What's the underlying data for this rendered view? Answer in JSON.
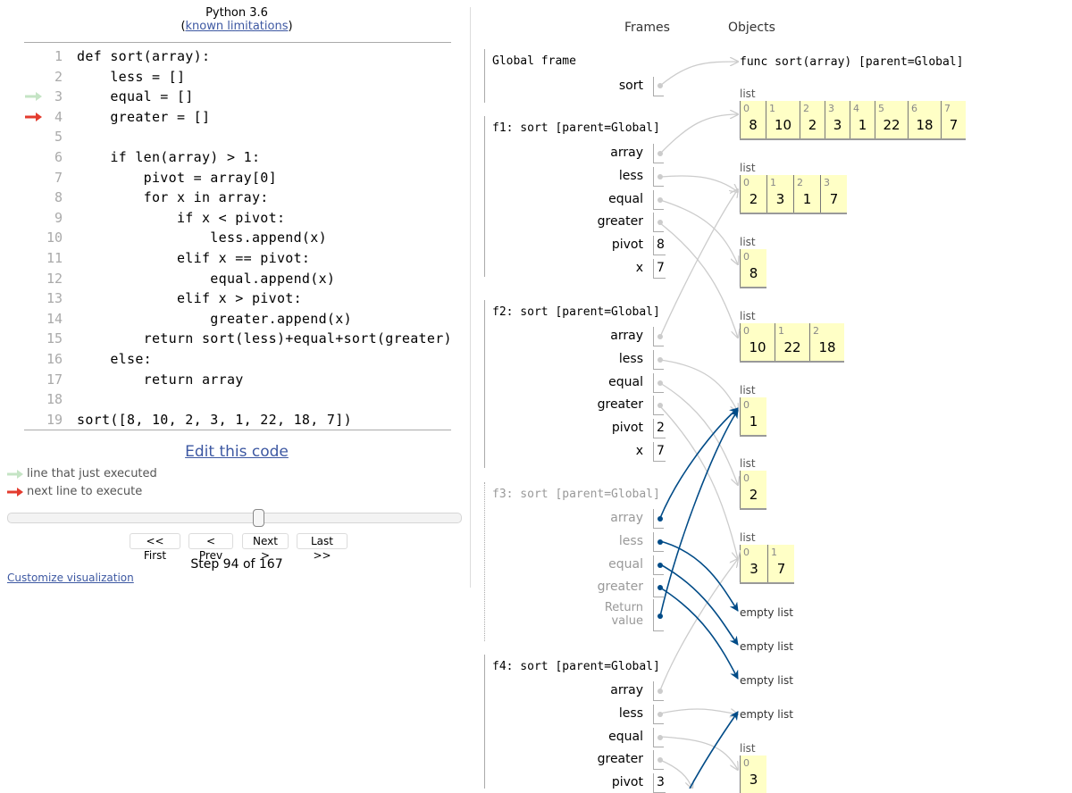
{
  "header": {
    "language": "Python 3.6",
    "limitations_prefix": "(",
    "limitations_link": "known limitations",
    "limitations_suffix": ")"
  },
  "code": {
    "lines": [
      {
        "num": "1",
        "text": "def sort(array):"
      },
      {
        "num": "2",
        "text": "    less = []"
      },
      {
        "num": "3",
        "text": "    equal = []"
      },
      {
        "num": "4",
        "text": "    greater = []"
      },
      {
        "num": "5",
        "text": ""
      },
      {
        "num": "6",
        "text": "    if len(array) > 1:"
      },
      {
        "num": "7",
        "text": "        pivot = array[0]"
      },
      {
        "num": "8",
        "text": "        for x in array:"
      },
      {
        "num": "9",
        "text": "            if x < pivot:"
      },
      {
        "num": "10",
        "text": "                less.append(x)"
      },
      {
        "num": "11",
        "text": "            elif x == pivot:"
      },
      {
        "num": "12",
        "text": "                equal.append(x)"
      },
      {
        "num": "13",
        "text": "            elif x > pivot:"
      },
      {
        "num": "14",
        "text": "                greater.append(x)"
      },
      {
        "num": "15",
        "text": "        return sort(less)+equal+sort(greater)"
      },
      {
        "num": "16",
        "text": "    else:"
      },
      {
        "num": "17",
        "text": "        return array"
      },
      {
        "num": "18",
        "text": ""
      },
      {
        "num": "19",
        "text": "sort([8, 10, 2, 3, 1, 22, 18, 7])"
      }
    ],
    "just_executed_line": 3,
    "next_line": 4
  },
  "edit_link": "Edit this code",
  "legend": {
    "just_executed": "line that just executed",
    "next_to_execute": "next line to execute"
  },
  "colors": {
    "just_executed_arrow": "#c5e4c5",
    "next_arrow": "#e33b2e",
    "link": "#3d58a2",
    "list_bg": "#ffffc6",
    "active_pointer": "#004b87",
    "inactive_pointer": "#cccccc"
  },
  "navigation": {
    "first": "<< First",
    "prev": "< Prev",
    "next": "Next >",
    "last": "Last >>",
    "step_text": "Step 94 of 167",
    "current_step": 94,
    "total_steps": 167
  },
  "customize_link": "Customize visualization",
  "viz": {
    "frames_header": "Frames",
    "objects_header": "Objects",
    "frames": [
      {
        "title": "Global frame",
        "vars": [
          {
            "name": "sort",
            "value": ""
          }
        ]
      },
      {
        "title": "f1: sort [parent=Global]",
        "vars": [
          {
            "name": "array",
            "value": ""
          },
          {
            "name": "less",
            "value": ""
          },
          {
            "name": "equal",
            "value": ""
          },
          {
            "name": "greater",
            "value": ""
          },
          {
            "name": "pivot",
            "value": "8"
          },
          {
            "name": "x",
            "value": "7"
          }
        ]
      },
      {
        "title": "f2: sort [parent=Global]",
        "vars": [
          {
            "name": "array",
            "value": ""
          },
          {
            "name": "less",
            "value": ""
          },
          {
            "name": "equal",
            "value": ""
          },
          {
            "name": "greater",
            "value": ""
          },
          {
            "name": "pivot",
            "value": "2"
          },
          {
            "name": "x",
            "value": "7"
          }
        ]
      },
      {
        "title": "f3: sort [parent=Global]",
        "vars": [
          {
            "name": "array",
            "value": ""
          },
          {
            "name": "less",
            "value": ""
          },
          {
            "name": "equal",
            "value": ""
          },
          {
            "name": "greater",
            "value": ""
          },
          {
            "name": "return_line1",
            "value": "Return"
          },
          {
            "name": "return_line2",
            "value": "value"
          }
        ]
      },
      {
        "title": "f4: sort [parent=Global]",
        "vars": [
          {
            "name": "array",
            "value": ""
          },
          {
            "name": "less",
            "value": ""
          },
          {
            "name": "equal",
            "value": ""
          },
          {
            "name": "greater",
            "value": ""
          },
          {
            "name": "pivot",
            "value": "3"
          }
        ]
      }
    ],
    "objects": {
      "func": "func sort(array) [parent=Global]",
      "list_label": "list",
      "empty_label": "empty list",
      "lists": [
        {
          "idx": [
            "0",
            "1",
            "2",
            "3",
            "4",
            "5",
            "6",
            "7"
          ],
          "vals": [
            "8",
            "10",
            "2",
            "3",
            "1",
            "22",
            "18",
            "7"
          ]
        },
        {
          "idx": [
            "0",
            "1",
            "2",
            "3"
          ],
          "vals": [
            "2",
            "3",
            "1",
            "7"
          ]
        },
        {
          "idx": [
            "0"
          ],
          "vals": [
            "8"
          ]
        },
        {
          "idx": [
            "0",
            "1",
            "2"
          ],
          "vals": [
            "10",
            "22",
            "18"
          ]
        },
        {
          "idx": [
            "0"
          ],
          "vals": [
            "1"
          ]
        },
        {
          "idx": [
            "0"
          ],
          "vals": [
            "2"
          ]
        },
        {
          "idx": [
            "0",
            "1"
          ],
          "vals": [
            "3",
            "7"
          ]
        },
        {
          "idx": [
            "0"
          ],
          "vals": [
            "3"
          ]
        }
      ]
    }
  }
}
